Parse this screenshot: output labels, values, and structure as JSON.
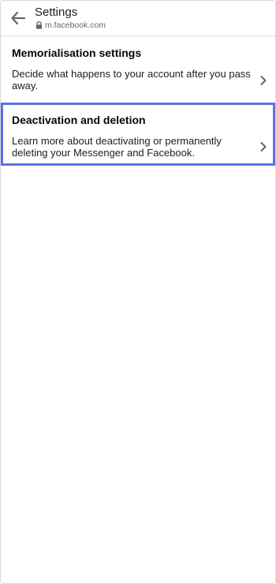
{
  "header": {
    "title": "Settings",
    "url": "m.facebook.com",
    "back_icon": "arrow-left-icon",
    "lock_icon": "lock-icon"
  },
  "items": [
    {
      "title": "Memorialisation settings",
      "description": "Decide what happens to your account after you pass away.",
      "icon": "chevron-right-icon"
    },
    {
      "title": "Deactivation and deletion",
      "description": "Learn more about deactivating or permanently deleting your Messenger and Facebook.",
      "icon": "chevron-right-icon"
    }
  ],
  "colors": {
    "highlight_border": "#5b72e0",
    "text_primary": "#1c1e21",
    "text_secondary": "#65676b"
  }
}
